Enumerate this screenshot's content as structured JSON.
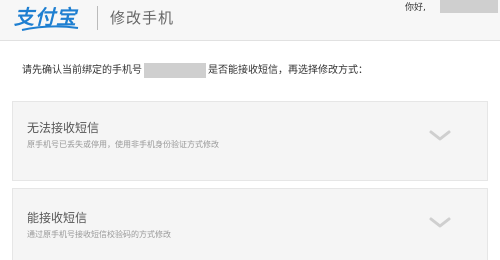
{
  "header": {
    "logo_text": "支付宝",
    "title": "修改手机",
    "greeting": "你好,"
  },
  "prompt": {
    "before": "请先确认当前绑定的手机号",
    "after": "是否能接收短信，再选择修改方式："
  },
  "options": [
    {
      "title": "无法接收短信",
      "description": "原手机号已丢失或停用，使用非手机身份验证方式修改",
      "icon": "chevron-down-icon"
    },
    {
      "title": "能接收短信",
      "description": "通过原手机号接收短信校验码的方式修改",
      "icon": "chevron-down-icon"
    }
  ],
  "colors": {
    "brand": "#1e7fd1",
    "header_bg": "#f7f7f7",
    "card_bg": "#f5f5f5",
    "mask": "#cfcfcf"
  }
}
